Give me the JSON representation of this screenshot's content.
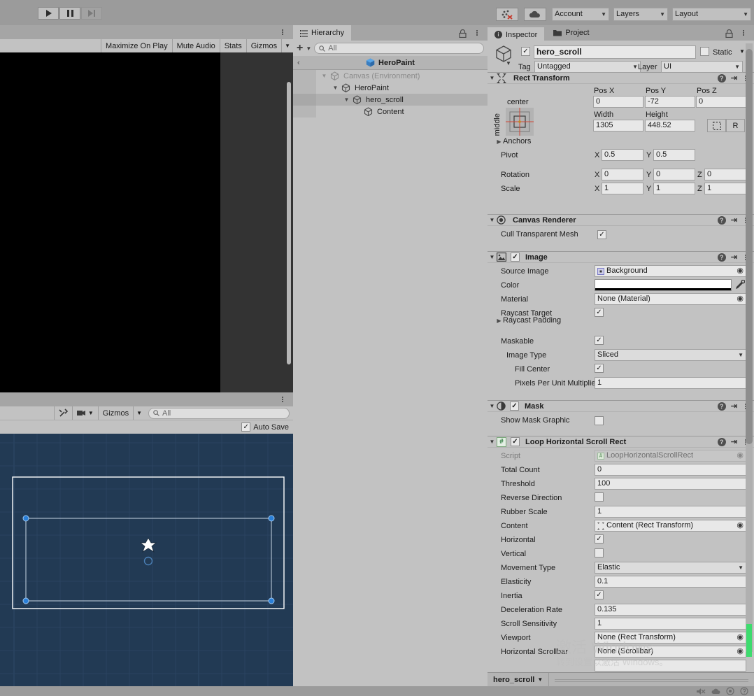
{
  "toolbar": {
    "play_icon": "play-icon",
    "pause_icon": "pause-icon",
    "step_icon": "step-icon",
    "collab_icon": "collab-error-icon",
    "cloud_icon": "cloud-icon",
    "account_label": "Account",
    "layers_label": "Layers",
    "layout_label": "Layout"
  },
  "game_view": {
    "toolbar": {
      "maximize_on_play": "Maximize On Play",
      "mute_audio": "Mute Audio",
      "stats": "Stats",
      "gizmos": "Gizmos"
    }
  },
  "scene_view": {
    "toolbar": {
      "tools_icon": "tools-icon",
      "camera_icon": "camera-icon",
      "gizmos_label": "Gizmos",
      "search_placeholder": "All",
      "search_icon": "search-icon"
    },
    "auto_save_label": "Auto Save",
    "auto_save_checked": true
  },
  "hierarchy": {
    "tab_label": "Hierarchy",
    "tab_icon": "hierarchy-icon",
    "lock_icon": "lock-icon",
    "menu_icon": "kebab-icon",
    "add_label": "+",
    "search_placeholder": "All",
    "breadcrumb": "HeroPaint",
    "back_icon": "chevron-left-icon",
    "items": [
      {
        "label": "Canvas (Environment)",
        "indent": 0,
        "expanded": true,
        "selected": false,
        "dim": true
      },
      {
        "label": "HeroPaint",
        "indent": 1,
        "expanded": true,
        "selected": false,
        "dim": false
      },
      {
        "label": "hero_scroll",
        "indent": 2,
        "expanded": true,
        "selected": true,
        "dim": false
      },
      {
        "label": "Content",
        "indent": 3,
        "expanded": false,
        "selected": false,
        "dim": false
      }
    ]
  },
  "inspector": {
    "tabs": [
      {
        "label": "Inspector",
        "icon": "info-icon",
        "active": true
      },
      {
        "label": "Project",
        "icon": "folder-icon",
        "active": false
      }
    ],
    "lock_icon": "lock-icon",
    "menu_icon": "kebab-icon",
    "object_enabled": true,
    "object_name": "hero_scroll",
    "static_label": "Static",
    "static_checked": false,
    "tag_label": "Tag",
    "tag_value": "Untagged",
    "layer_label": "Layer",
    "layer_value": "UI",
    "components": [
      {
        "title": "Rect Transform",
        "icon": "rect-transform-icon",
        "anchor_preset_top": "center",
        "anchor_preset_side": "middle",
        "fields": {
          "pos_x_label": "Pos X",
          "pos_x": "0",
          "pos_y_label": "Pos Y",
          "pos_y": "-72",
          "pos_z_label": "Pos Z",
          "pos_z": "0",
          "width_label": "Width",
          "width": "1305",
          "height_label": "Height",
          "height": "448.52",
          "blueprint_icon": "blueprint-icon",
          "raw_label": "R",
          "anchors_label": "Anchors",
          "pivot_label": "Pivot",
          "pivot_x": "0.5",
          "pivot_y": "0.5",
          "rotation_label": "Rotation",
          "rot_x": "0",
          "rot_y": "0",
          "rot_z": "0",
          "scale_label": "Scale",
          "scale_x": "1",
          "scale_y": "1",
          "scale_z": "1"
        }
      },
      {
        "title": "Canvas Renderer",
        "icon": "canvas-renderer-icon",
        "rows": [
          {
            "label": "Cull Transparent Mesh",
            "type": "checkbox",
            "value": true
          }
        ]
      },
      {
        "title": "Image",
        "icon": "image-icon",
        "enabled": true,
        "rows": [
          {
            "label": "Source Image",
            "type": "object",
            "value": "Background",
            "icon": "sprite-icon"
          },
          {
            "label": "Color",
            "type": "color",
            "value": "#ffffff",
            "picker_icon": "eyedropper-icon"
          },
          {
            "label": "Material",
            "type": "object",
            "value": "None (Material)"
          },
          {
            "label": "Raycast Target",
            "type": "checkbox",
            "value": true
          },
          {
            "label": "Raycast Padding",
            "type": "foldout"
          },
          {
            "label": "Maskable",
            "type": "checkbox",
            "value": true
          },
          {
            "label": "Image Type",
            "type": "dropdown",
            "value": "Sliced",
            "indent": 1
          },
          {
            "label": "Fill Center",
            "type": "checkbox",
            "value": true,
            "indent": 2
          },
          {
            "label": "Pixels Per Unit Multiplier",
            "type": "text",
            "value": "1",
            "indent": 2
          }
        ]
      },
      {
        "title": "Mask",
        "icon": "mask-icon",
        "enabled": true,
        "rows": [
          {
            "label": "Show Mask Graphic",
            "type": "checkbox",
            "value": false
          }
        ]
      },
      {
        "title": "Loop Horizontal Scroll Rect",
        "icon": "script-icon",
        "enabled": true,
        "rows": [
          {
            "label": "Script",
            "type": "object",
            "value": "LoopHorizontalScrollRect",
            "disabled": true,
            "icon": "script-icon"
          },
          {
            "label": "Total Count",
            "type": "text",
            "value": "0"
          },
          {
            "label": "Threshold",
            "type": "text",
            "value": "100"
          },
          {
            "label": "Reverse Direction",
            "type": "checkbox",
            "value": false
          },
          {
            "label": "Rubber Scale",
            "type": "text",
            "value": "1"
          },
          {
            "label": "Content",
            "type": "object",
            "value": "Content (Rect Transform)",
            "icon": "rect-transform-icon"
          },
          {
            "label": "Horizontal",
            "type": "checkbox",
            "value": true
          },
          {
            "label": "Vertical",
            "type": "checkbox",
            "value": false
          },
          {
            "label": "Movement Type",
            "type": "dropdown",
            "value": "Elastic"
          },
          {
            "label": "Elasticity",
            "type": "text",
            "value": "0.1"
          },
          {
            "label": "Inertia",
            "type": "checkbox",
            "value": true
          },
          {
            "label": "Deceleration Rate",
            "type": "text",
            "value": "0.135"
          },
          {
            "label": "Scroll Sensitivity",
            "type": "text",
            "value": "1"
          },
          {
            "label": "Viewport",
            "type": "object",
            "value": "None (Rect Transform)"
          },
          {
            "label": "Horizontal Scrollbar",
            "type": "object",
            "value": "None (Scrollbar)"
          }
        ]
      }
    ],
    "breadcrumb_label": "hero_scroll"
  },
  "watermark": {
    "line1": "激活 Windows",
    "line2": "转到设置以激活 Windows。"
  },
  "colors": {
    "scene_bg": "#223a54",
    "handle_blue": "#1f7fe0",
    "accent_green": "#3ddc6e",
    "panel": "#c2c2c2"
  }
}
